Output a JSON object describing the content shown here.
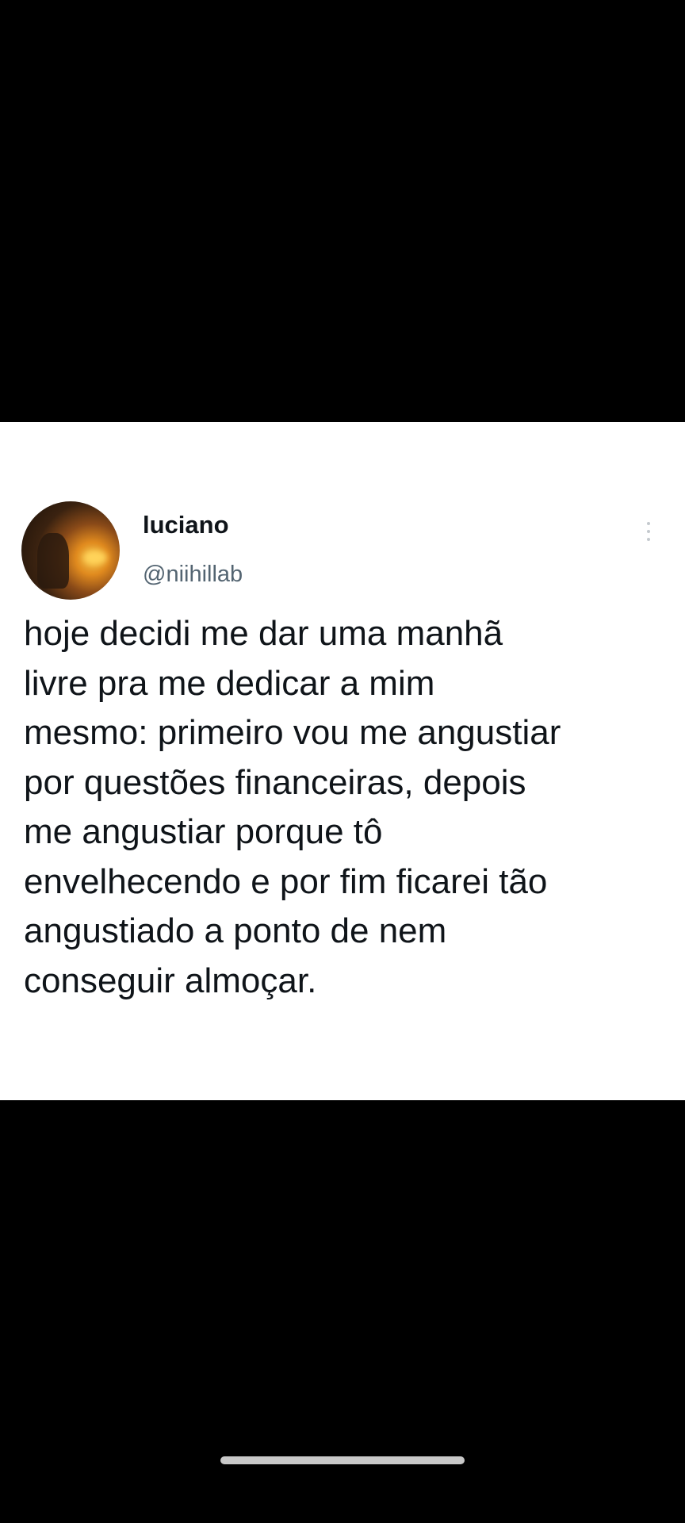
{
  "tweet": {
    "display_name": "luciano",
    "handle": "@niihillab",
    "text": "hoje decidi me dar uma manhã\nlivre pra me dedicar a mim\nmesmo: primeiro vou me angustiar\npor questões financeiras, depois\nme angustiar porque tô\nenvelhecendo e por fim ficarei tão\nangustiado a ponto de nem\nconseguir almoçar."
  },
  "icons": {
    "more": "more-vertical-icon"
  },
  "colors": {
    "background": "#000000",
    "card": "#ffffff",
    "text_primary": "#0f1419",
    "text_secondary": "#536471"
  }
}
